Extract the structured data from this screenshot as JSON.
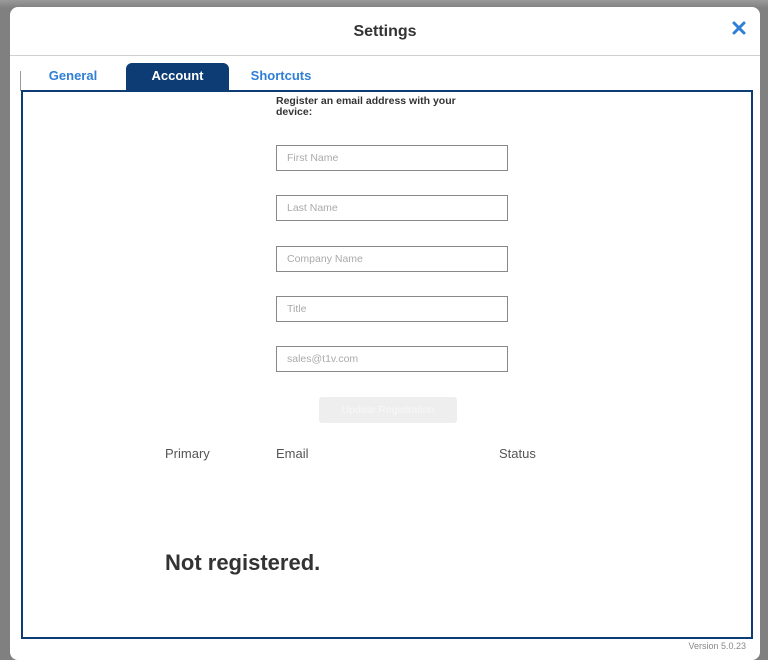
{
  "dialog": {
    "title": "Settings",
    "close_icon": "close-x-icon",
    "accent_color": "#2f7fd6",
    "active_tab_color": "#0d3b73"
  },
  "tabs": [
    {
      "label": "General",
      "active": false
    },
    {
      "label": "Account",
      "active": true
    },
    {
      "label": "Shortcuts",
      "active": false
    }
  ],
  "account": {
    "prompt": "Register an email address with your device:",
    "fields": {
      "first_name": {
        "placeholder": "First Name",
        "value": ""
      },
      "last_name": {
        "placeholder": "Last Name",
        "value": ""
      },
      "company_name": {
        "placeholder": "Company Name",
        "value": ""
      },
      "title": {
        "placeholder": "Title",
        "value": ""
      },
      "email": {
        "placeholder": "sales@t1v.com",
        "value": ""
      }
    },
    "update_button_label": "Update Registration",
    "table_headers": {
      "primary": "Primary",
      "email": "Email",
      "status": "Status"
    },
    "registration_status": "Not registered."
  },
  "footer": {
    "version": "Version 5.0.23"
  }
}
